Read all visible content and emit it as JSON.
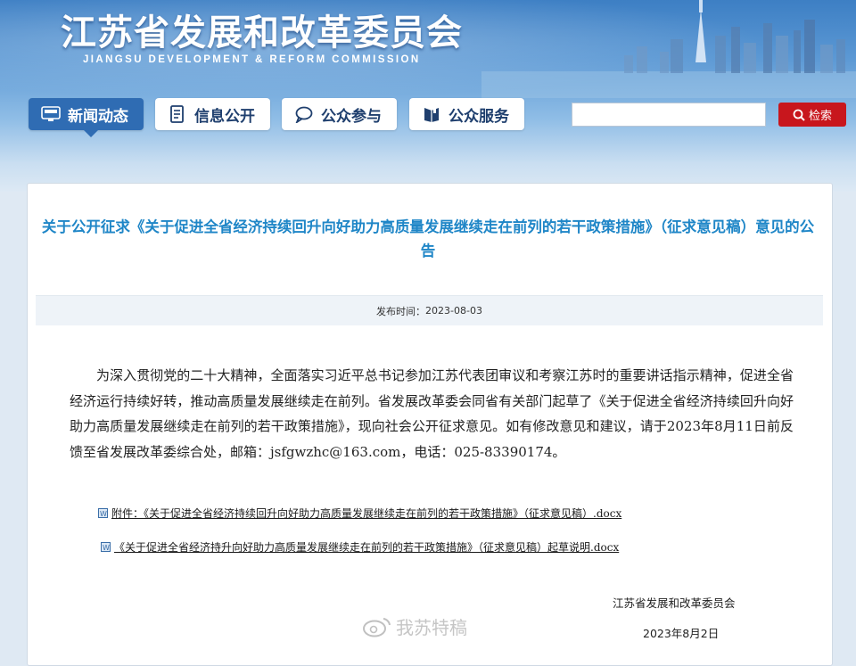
{
  "header": {
    "title": "江苏省发展和改革委员会",
    "subtitle": "JIANGSU DEVELOPMENT & REFORM COMMISSION"
  },
  "nav": [
    {
      "label": "新闻动态",
      "icon": "news-icon",
      "active": true
    },
    {
      "label": "信息公开",
      "icon": "document-icon",
      "active": false
    },
    {
      "label": "公众参与",
      "icon": "chat-icon",
      "active": false
    },
    {
      "label": "公众服务",
      "icon": "book-icon",
      "active": false
    }
  ],
  "search": {
    "placeholder": "",
    "button_label": "检索",
    "button_icon": "search-icon"
  },
  "article": {
    "title": "关于公开征求《关于促进全省经济持续回升向好助力高质量发展继续走在前列的若干政策措施》（征求意见稿）意见的公告",
    "publish_label": "发布时间：",
    "publish_date": "2023-08-03",
    "body": "为深入贯彻党的二十大精神，全面落实习近平总书记参加江苏代表团审议和考察江苏时的重要讲话指示精神，促进全省经济运行持续好转，推动高质量发展继续走在前列。省发展改革委会同省有关部门起草了《关于促进全省经济持续回升向好助力高质量发展继续走在前列的若干政策措施》，现向社会公开征求意见。如有修改意见和建议，请于2023年8月11日前反馈至省发展改革委综合处，邮箱：jsfgwzhc@163.com，电话：025-83390174。",
    "attachments": [
      "附件：《关于促进全省经济持续回升向好助力高质量发展继续走在前列的若干政策措施》（征求意见稿）.docx",
      "《关于促进全省经济持升向好助力高质量发展继续走在前列的若干政策措施》（征求意见稿）起草说明.docx"
    ],
    "signature_org": "江苏省发展和改革委员会",
    "signature_date": "2023年8月2日"
  },
  "watermark": {
    "text": "我苏特稿",
    "icon": "weibo-icon"
  },
  "colors": {
    "title": "#1f86c7",
    "nav_active": "#2f6cb3",
    "search_button": "#c8161d"
  }
}
